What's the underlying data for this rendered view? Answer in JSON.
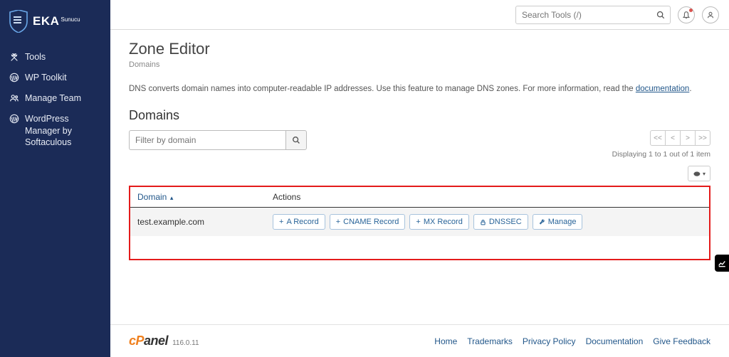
{
  "brand": {
    "name": "EKA",
    "suffix": "Sunucu"
  },
  "sidebar": {
    "items": [
      {
        "label": "Tools"
      },
      {
        "label": "WP Toolkit"
      },
      {
        "label": "Manage Team"
      },
      {
        "label": "WordPress Manager by Softaculous"
      }
    ]
  },
  "topbar": {
    "search_placeholder": "Search Tools (/)"
  },
  "page": {
    "title": "Zone Editor",
    "breadcrumb": "Domains",
    "desc_pre": "DNS converts domain names into computer-readable IP addresses. Use this feature to manage DNS zones. For more information, read the ",
    "desc_link": "documentation",
    "desc_post": ".",
    "section": "Domains",
    "filter_placeholder": "Filter by domain",
    "pager": {
      "first": "<<",
      "prev": "<",
      "next": ">",
      "last": ">>",
      "text": "Displaying 1 to 1 out of 1 item"
    }
  },
  "table": {
    "col_domain": "Domain",
    "col_actions": "Actions",
    "rows": [
      {
        "domain": "test.example.com",
        "actions": {
          "a": "A Record",
          "cname": "CNAME Record",
          "mx": "MX Record",
          "dnssec": "DNSSEC",
          "manage": "Manage"
        }
      }
    ]
  },
  "footer": {
    "version": "116.0.11",
    "links": {
      "home": "Home",
      "trademarks": "Trademarks",
      "privacy": "Privacy Policy",
      "docs": "Documentation",
      "feedback": "Give Feedback"
    }
  }
}
